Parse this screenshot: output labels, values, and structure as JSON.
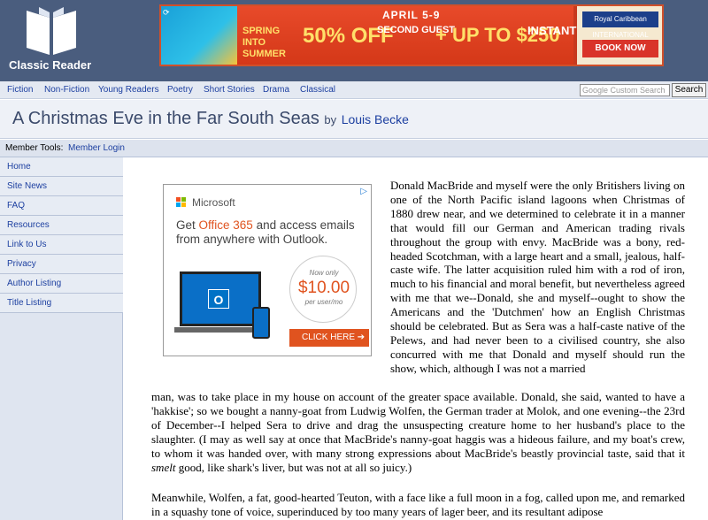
{
  "site": {
    "name": "Classic Reader"
  },
  "banner_ad": {
    "date": "APRIL 5-9",
    "spring": "SPRING INTO SUMMER",
    "discount": "50% OFF",
    "second": "SECOND GUEST",
    "upto": "+ UP TO $250",
    "instant": "INSTANT SAVINGS*",
    "brand": "Royal Caribbean INTERNATIONAL",
    "cta": "BOOK NOW"
  },
  "nav": {
    "items": [
      "Fiction",
      "Non-Fiction",
      "Young Readers",
      "Poetry",
      "Short Stories",
      "Drama",
      "Classical"
    ],
    "search_placeholder": "Google Custom Search",
    "search_button": "Search"
  },
  "page": {
    "title": "A Christmas Eve in the Far South Seas",
    "by": "by",
    "author": "Louis Becke"
  },
  "member_tools": {
    "label": "Member Tools:",
    "login": "Member Login"
  },
  "sidebar": {
    "items": [
      "Home",
      "Site News",
      "FAQ",
      "Resources",
      "Link to Us",
      "Privacy",
      "Author Listing",
      "Title Listing"
    ]
  },
  "ms_ad": {
    "brand": "Microsoft",
    "headline_pre": "Get ",
    "headline_product": "Office 365",
    "headline_post": " and access emails from anywhere with Outlook.",
    "price_label": "Now only",
    "price": "$10.00",
    "price_unit": "per user/mo",
    "cta": "CLICK HERE ➔"
  },
  "article": {
    "p1_start": "Donald MacBride and myself were the only Britishers living on one of the North Pacific island lagoons when Christmas of 1880 drew near, and we determined to celebrate it in a manner that would fill our German and American trading rivals throughout the group with envy. MacBride was a bony, red-headed Scotchman, with a large heart and a small, jealous, half-caste wife. The latter acquisition ruled him with a rod of iron, much to his financial and moral benefit, but nevertheless agreed with me that we--Donald, she and myself--ought to show the Americans and the 'Dutchmen' how an English Christmas should be celebrated. But as Sera was a half-caste native of the Pelews, and had never been to a civilised country, she also concurred with me that Donald and myself should run the show, which, although I was not a married",
    "p1_end_a": "man, was to take place in my house on account of the greater space available. Donald, she said, wanted to have a 'hakkise'; so we bought a nanny-goat from Ludwig Wolfen, the German trader at Molok, and one evening--the 23rd of December--I helped Sera to drive and drag the unsuspecting creature home to her husband's place to the slaughter. (I may as well say at once that MacBride's nanny-goat haggis was a hideous failure, and my boat's crew, to whom it was handed over, with many strong expressions about MacBride's beastly provincial taste, said that it ",
    "p1_end_em": "smelt",
    "p1_end_b": " good, like shark's liver, but was not at all so juicy.)",
    "p2": "Meanwhile, Wolfen, a fat, good-hearted Teuton, with a face like a full moon in a fog, called upon me, and remarked in a squashy tone of voice, superinduced by too many years of lager beer, and its resultant adipose"
  }
}
